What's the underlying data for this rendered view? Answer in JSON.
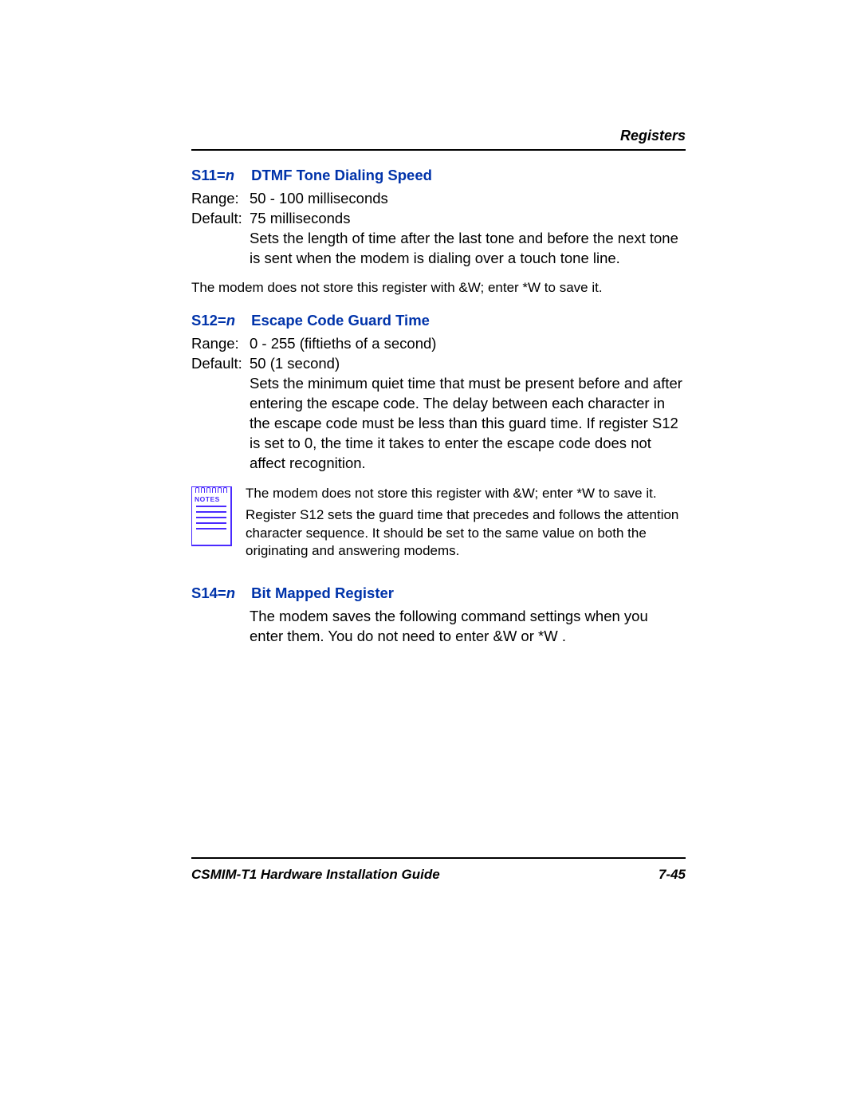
{
  "header": {
    "section": "Registers"
  },
  "s11": {
    "code": "S11=",
    "var": "n",
    "title": "DTMF Tone Dialing Speed",
    "range_label": "Range:",
    "range_value": "50 - 100 milliseconds",
    "default_label": "Default:",
    "default_value": "75 milliseconds",
    "desc": "Sets the length of time after the last tone and before the next tone is sent when the modem is dialing over a touch tone line.",
    "note": "The modem does not store this register with &W; enter *W to save it."
  },
  "s12": {
    "code": "S12=",
    "var": "n",
    "title": "Escape Code Guard Time",
    "range_label": "Range:",
    "range_value": "0 - 255 (fiftieths of a second)",
    "default_label": "Default:",
    "default_value": "50 (1 second)",
    "desc": "Sets the minimum quiet time that must be present before and after entering the escape code. The delay between each character in the escape code must be less than this guard time. If register S12 is set to 0, the time it takes to enter the escape code does not affect recognition.",
    "notes_label": "NOTES",
    "note1": "The modem does not store this register with &W; enter *W to save it.",
    "note2": "Register S12 sets the guard time that precedes and follows the attention character sequence. It should be set to the same value on both the originating and answering modems."
  },
  "s14": {
    "code": "S14=",
    "var": "n",
    "title": "Bit Mapped Register",
    "desc": "The modem saves the following command settings when you enter them. You do not need to enter &W or *W ."
  },
  "footer": {
    "doc": "CSMIM-T1 Hardware Installation Guide",
    "page": "7-45"
  }
}
